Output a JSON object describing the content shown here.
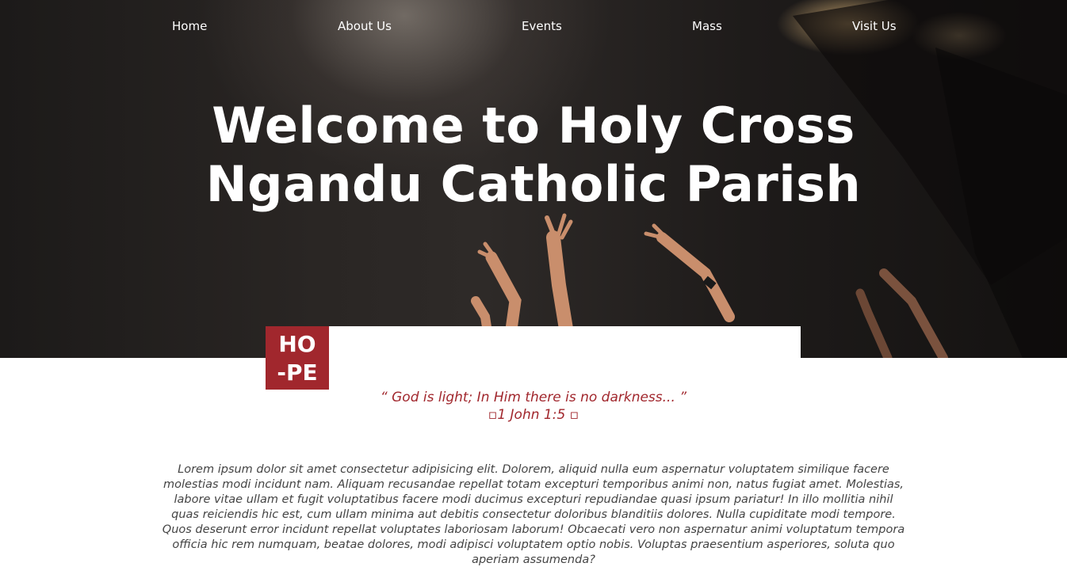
{
  "nav": {
    "items": [
      "Home",
      "About Us",
      "Events",
      "Mass",
      "Visit Us"
    ]
  },
  "hero": {
    "title": "Welcome to Holy Cross Ngandu Catholic Parish"
  },
  "hope_badge": {
    "line1": "HO",
    "line2": "-PE"
  },
  "quote": {
    "text": "“ God is light; In Him there is no darkness... ”",
    "reference": "▫1 John 1:5 ▫"
  },
  "body_text": "Lorem ipsum dolor sit amet consectetur adipisicing elit. Dolorem, aliquid nulla eum aspernatur voluptatem similique facere molestias modi incidunt nam. Aliquam recusandae repellat totam excepturi temporibus animi non, natus fugiat amet. Molestias, labore vitae ullam et fugit voluptatibus facere modi ducimus excepturi repudiandae quasi ipsum pariatur! In illo mollitia nihil quas reiciendis hic est, cum ullam minima aut debitis consectetur doloribus blanditiis dolores. Nulla cupiditate modi tempore. Quos deserunt error incidunt repellat voluptates laboriosam laborum! Obcaecati vero non aspernatur animi voluptatum tempora officia hic rem numquam, beatae dolores, modi adipisci voluptatem optio nobis. Voluptas praesentium asperiores, soluta quo aperiam assumenda?",
  "colors": {
    "accent": "#a1272d",
    "hero_overlay": "#1c1a19",
    "nav_text": "#ffffff",
    "body_text": "#444444"
  }
}
